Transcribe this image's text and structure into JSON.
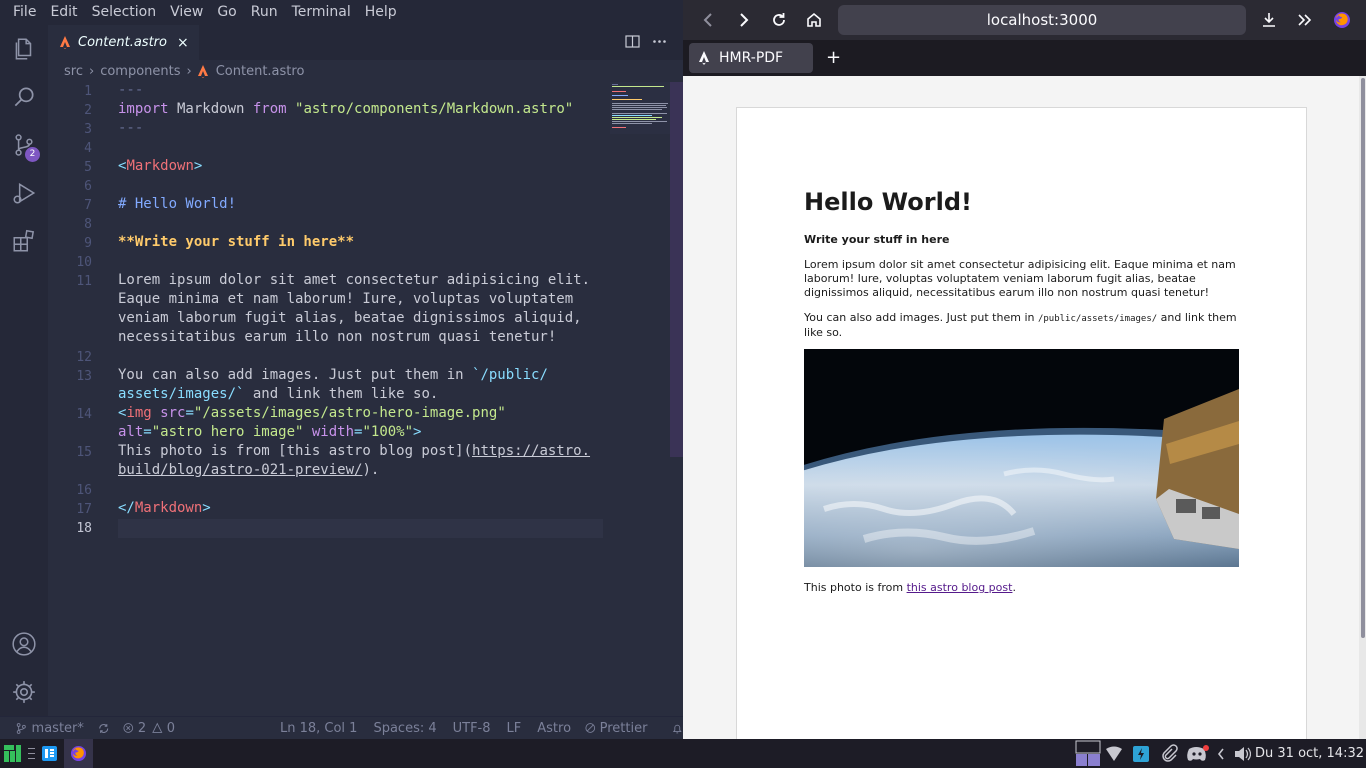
{
  "menu": [
    "File",
    "Edit",
    "Selection",
    "View",
    "Go",
    "Run",
    "Terminal",
    "Help"
  ],
  "activity": {
    "explorer_icon": "files-icon",
    "search_icon": "search-icon",
    "scm_icon": "source-control-icon",
    "scm_badge": "2",
    "debug_icon": "run-debug-icon",
    "extensions_icon": "extensions-icon",
    "account_icon": "account-icon",
    "settings_icon": "gear-icon"
  },
  "editor_tab": {
    "filename": "Content.astro",
    "close": "×"
  },
  "breadcrumb": [
    "src",
    "components",
    "Content.astro"
  ],
  "code": {
    "line_numbers": [
      "1",
      "2",
      "3",
      "4",
      "5",
      "6",
      "7",
      "8",
      "9",
      "10",
      "11",
      "12",
      "13",
      "14",
      "15",
      "16",
      "17",
      "18"
    ],
    "l1": "---",
    "l2_import": "import",
    "l2_name": " Markdown ",
    "l2_from": "from",
    "l2_str": " \"astro/components/Markdown.astro\"",
    "l3": "---",
    "l5_open": "<",
    "l5_tag": "Markdown",
    "l5_close": ">",
    "l7": "# Hello World!",
    "l9_stars_a": "**",
    "l9_text": "Write your stuff in here",
    "l9_stars_b": "**",
    "l11_a": "Lorem ipsum dolor sit amet consectetur adipisicing elit.",
    "l11_b": "Eaque minima et nam laborum! Iure, voluptas voluptatem",
    "l11_c": "veniam laborum fugit alias, beatae dignissimos aliquid,",
    "l11_d": "necessitatibus earum illo non nostrum quasi tenetur!",
    "l13_a_text": "You can also add images. Just put them in ",
    "l13_a_code": "`/public/",
    "l13_b_code": "assets/images/`",
    "l13_b_text": " and link them like so.",
    "l14_a_open": "<",
    "l14_a_tag": "img",
    "l14_a_attr": " src",
    "l14_a_eq": "=",
    "l14_a_val": "\"/assets/images/astro-hero-image.png\"",
    "l14_b_attr": "alt",
    "l14_b_eq": "=",
    "l14_b_val": "\"astro hero image\"",
    "l14_b_attr2": " width",
    "l14_b_eq2": "=",
    "l14_b_val2": "\"100%\"",
    "l14_b_close": ">",
    "l15_a_text": "This photo is from [this astro blog post](",
    "l15_a_link": "https://astro.",
    "l15_b_link": "build/blog/astro-021-preview/",
    "l15_b_text": ").",
    "l17_open": "</",
    "l17_tag": "Markdown",
    "l17_close": ">"
  },
  "status": {
    "branch": "master*",
    "errors": "2",
    "warnings": "0",
    "position": "Ln 18, Col 1",
    "spaces": "Spaces: 4",
    "encoding": "UTF-8",
    "eol": "LF",
    "language": "Astro",
    "formatter": "Prettier"
  },
  "browser": {
    "url": "localhost:3000",
    "tab_title": "HMR-PDF",
    "new_tab": "+"
  },
  "rendered": {
    "h1": "Hello World!",
    "bold": "Write your stuff in here",
    "para1": "Lorem ipsum dolor sit amet consectetur adipisicing elit. Eaque minima et nam laborum! Iure, voluptas voluptatem veniam laborum fugit alias, beatae dignissimos aliquid, necessitatibus earum illo non nostrum quasi tenetur!",
    "para2_a": "You can also add images. Just put them in ",
    "para2_code": "/public/assets/images/",
    "para2_b": " and link them like so.",
    "caption_a": "This photo is from ",
    "caption_link": "this astro blog post",
    "caption_b": "."
  },
  "taskbar": {
    "clock": "Du 31 oct, 14:32"
  },
  "colors": {
    "editor_bg": "#292d3e",
    "accent": "#7e57c2",
    "tag": "#f07178",
    "string": "#c3e88d",
    "keyword": "#c792ea"
  }
}
